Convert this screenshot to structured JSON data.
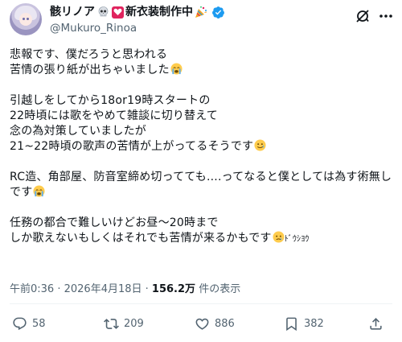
{
  "header": {
    "display_name": "骸リノア",
    "display_name_suffix": "新衣装制作中",
    "handle": "@Mukuro_Rinoa"
  },
  "tweet": {
    "lines": [
      "悲報です、僕だろうと思われる",
      "苦情の張り紙が出ちゃいました",
      "",
      "引越しをしてから18or19時スタートの",
      "22時頃には歌をやめて雑談に切り替えて",
      "念の為対策していましたが",
      "21~22時頃の歌声の苦情が上がってるそうです",
      "",
      "RC造、角部屋、防音室締め切ってても....ってなると僕としては為す術無し",
      "です",
      "",
      "任務の都合で難しいけどお昼～20時まで",
      "しか歌えないもしくはそれでも苦情が来るかもです",
      ""
    ],
    "trailing_text": "ﾄﾞｳｼﾖｳ"
  },
  "meta": {
    "time": "午前0:36",
    "date": "2026年4月18日",
    "views_count": "156.2万",
    "views_label": "件の表示"
  },
  "actions": {
    "replies": "58",
    "reposts": "209",
    "likes": "886",
    "views": "382"
  },
  "colors": {
    "verified": "#1d9bf0",
    "text": "#0f1419",
    "secondary": "#536471"
  }
}
